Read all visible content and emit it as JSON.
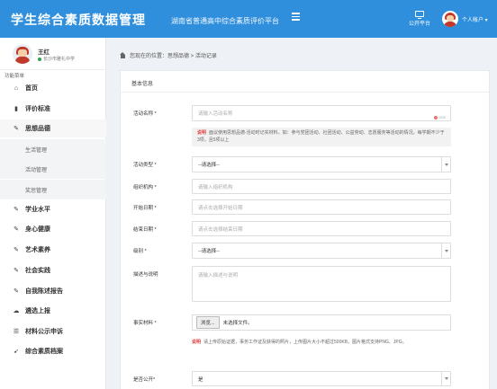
{
  "header": {
    "brand": "学生综合素质数据管理",
    "subtitle": "湖南省普通高中综合素质评价平台",
    "platform_label": "公开平台",
    "account_label": "个人帐户 ▾"
  },
  "sidebar": {
    "user_name": "王红",
    "school": "长沙市雅礼中学",
    "menu_caption": "功能菜单",
    "items": [
      {
        "label": "首页",
        "icon": "home-icon",
        "glyph": "⌂"
      },
      {
        "label": "评价标准",
        "icon": "book-icon",
        "glyph": "▮"
      },
      {
        "label": "思想品德",
        "icon": "edit-icon",
        "glyph": "✎"
      },
      {
        "label": "学业水平",
        "icon": "edit-icon",
        "glyph": "✎"
      },
      {
        "label": "身心健康",
        "icon": "edit-icon",
        "glyph": "✎"
      },
      {
        "label": "艺术素养",
        "icon": "edit-icon",
        "glyph": "✎"
      },
      {
        "label": "社会实践",
        "icon": "edit-icon",
        "glyph": "✎"
      },
      {
        "label": "自我陈述报告",
        "icon": "edit-icon",
        "glyph": "✎"
      },
      {
        "label": "遴选上报",
        "icon": "upload-icon",
        "glyph": "☁"
      },
      {
        "label": "材料公示申诉",
        "icon": "list-icon",
        "glyph": "☰"
      },
      {
        "label": "综合素质档案",
        "icon": "archive-icon",
        "glyph": "➹"
      }
    ],
    "subitems": [
      "生活管理",
      "活动管理",
      "奖惩管理"
    ]
  },
  "breadcrumb": "您现在的位置：思想品德 > 活动记录",
  "panel_title": "基本信息",
  "form": {
    "activity_name": {
      "label": "活动名称 *",
      "placeholder": "请输入活动名称",
      "counter": "0/50"
    },
    "name_note": {
      "tag": "说明",
      "text": "面议使用思想品德-活动时记实材料。如：参与党团活动、社团活动、公益劳动、志愿服务等活动的情况，每学期不少于3项，且5项以上"
    },
    "activity_type": {
      "label": "活动类型 *",
      "value": "--请选择--"
    },
    "organizer": {
      "label": "组织机构 *",
      "placeholder": "请输入组织机构"
    },
    "start_date": {
      "label": "开始日期 *",
      "placeholder": "请点击选择开始日期"
    },
    "end_date": {
      "label": "结束日期 *",
      "placeholder": "请点击选择结束日期"
    },
    "level": {
      "label": "级别 *",
      "value": "--请选择--"
    },
    "description": {
      "label": "描述与说明",
      "placeholder": "请输入描述与说明"
    },
    "evidence": {
      "label": "事实材料 *",
      "button": "浏览...",
      "status": "未选择文件。"
    },
    "evidence_note": {
      "tag": "说明",
      "text": "请上传原始证据，事务工作证及获得的照片，上传图片大小不超过500KB，图片格式支持PNG、JPG。"
    },
    "public": {
      "label": "是否公开*",
      "value": "是"
    }
  }
}
